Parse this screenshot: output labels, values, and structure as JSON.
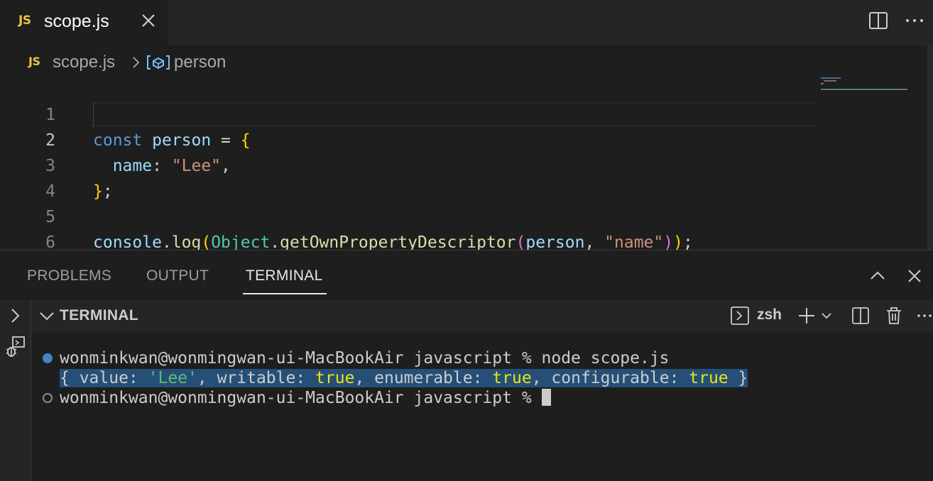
{
  "tab": {
    "badge": "JS",
    "title": "scope.js"
  },
  "breadcrumb": {
    "badge": "JS",
    "file": "scope.js",
    "symbol": "person"
  },
  "editor": {
    "line_numbers": [
      "1",
      "2",
      "3",
      "4",
      "5",
      "6"
    ],
    "current_line": 2,
    "code": {
      "l1": {
        "kw": "const",
        "sp1": " ",
        "name": "person",
        "eq": " = ",
        "brace": "{"
      },
      "l2": {
        "indent": "  ",
        "key": "name",
        "colon": ": ",
        "str": "\"Lee\"",
        "comma": ","
      },
      "l3": {
        "brace": "}",
        "semi": ";"
      },
      "l5": {
        "obj": "console",
        "dot1": ".",
        "fn1": "log",
        "p1": "(",
        "cls": "Object",
        "dot2": ".",
        "fn2": "getOwnPropertyDescriptor",
        "p2": "(",
        "arg1": "person",
        "comma": ", ",
        "arg2": "\"name\"",
        "p3": ")",
        "p4": ")",
        "semi": ";"
      }
    }
  },
  "panel": {
    "tabs": [
      "PROBLEMS",
      "OUTPUT",
      "TERMINAL"
    ],
    "active_tab": "TERMINAL",
    "section_title": "TERMINAL",
    "shell": "zsh"
  },
  "terminal": {
    "line1": "wonminkwan@wonmingwan-ui-MacBookAir javascript % node scope.js",
    "line2": {
      "open": "{ value: ",
      "value": "'Lee'",
      "w_label": ", writable: ",
      "w": "true",
      "e_label": ", enumerable: ",
      "e": "true",
      "c_label": ", configurable: ",
      "c": "true",
      "close": " }"
    },
    "line3": "wonminkwan@wonmingwan-ui-MacBookAir javascript % "
  },
  "colors": {
    "accent_js": "#e8c547",
    "selection": "#264f78",
    "command_dot": "#3f86c4"
  }
}
